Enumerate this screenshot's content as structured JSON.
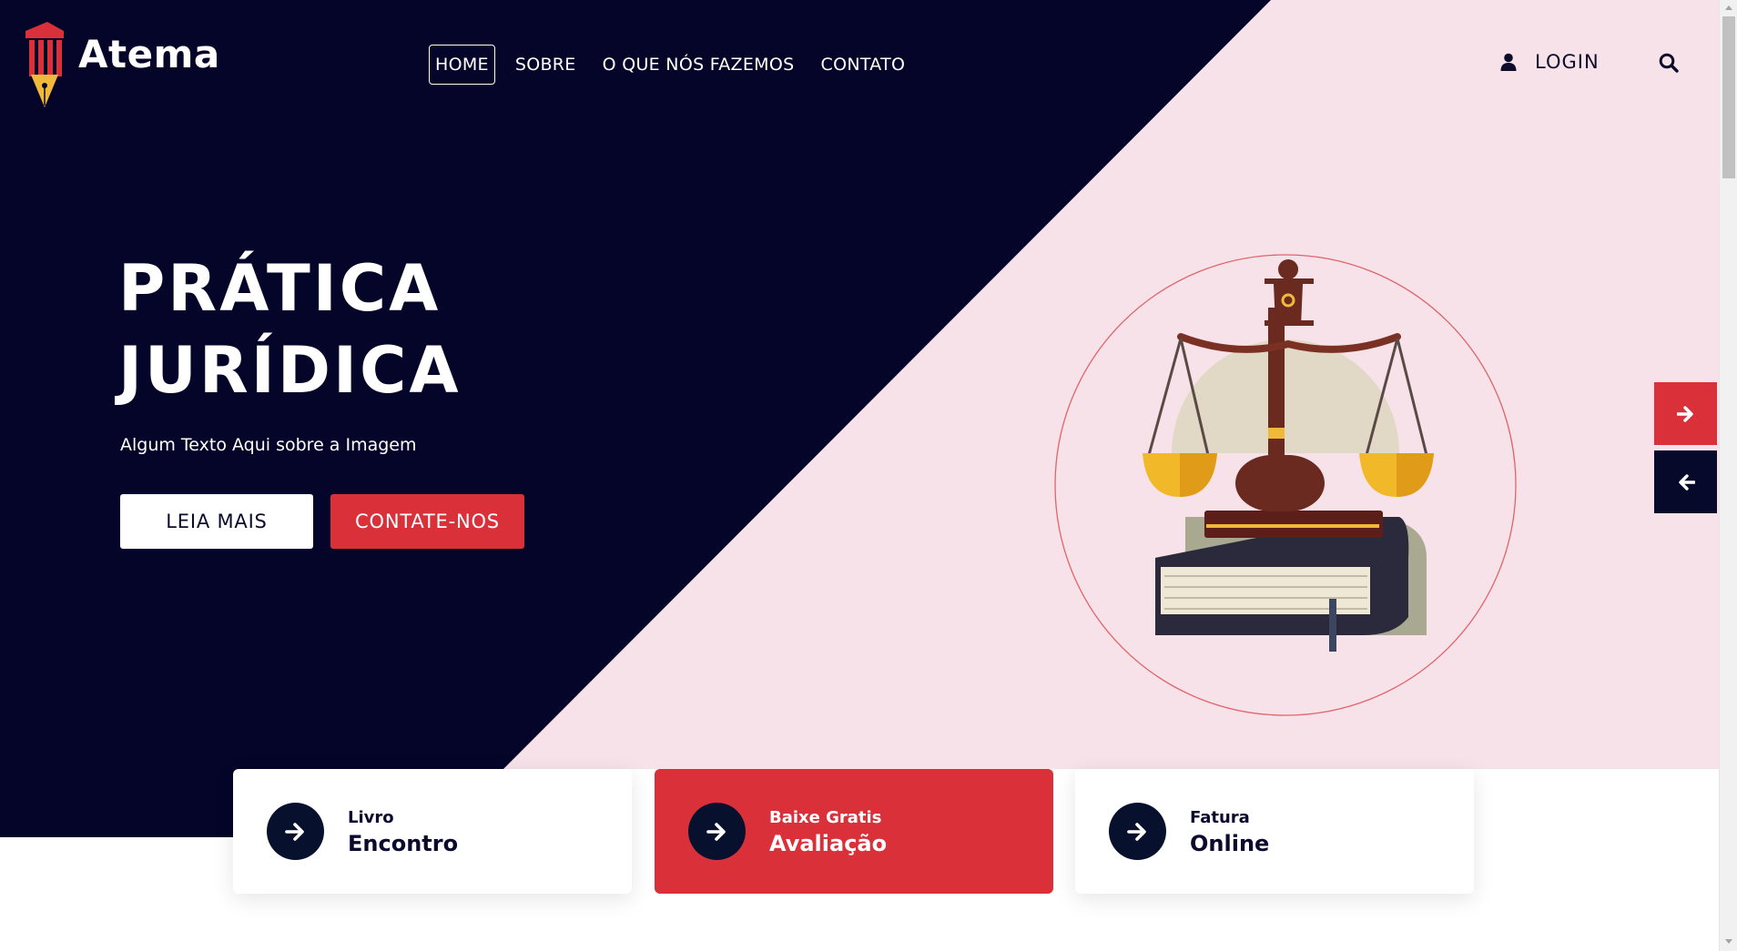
{
  "brand": {
    "name": "Atema"
  },
  "nav": {
    "items": [
      {
        "label": "HOME",
        "active": true
      },
      {
        "label": "SOBRE",
        "active": false
      },
      {
        "label": "O QUE NÓS FAZEMOS",
        "active": false
      },
      {
        "label": "CONTATO",
        "active": false
      }
    ]
  },
  "header": {
    "login_label": "LOGIN"
  },
  "hero": {
    "title_line1": "PRÁTICA",
    "title_line2": "JURÍDICA",
    "subtitle": "Algum Texto Aqui sobre a Imagem",
    "read_more_label": "LEIA MAIS",
    "contact_label": "CONTATE-NOS"
  },
  "cards": [
    {
      "small": "Livro",
      "big": "Encontro",
      "style": "light"
    },
    {
      "small": "Baixe Gratis",
      "big": "Avaliação",
      "style": "red"
    },
    {
      "small": "Fatura",
      "big": "Online",
      "style": "light"
    }
  ],
  "colors": {
    "navy": "#07092b",
    "accent_red": "#d9303a",
    "pink_bg": "#f6e2e8"
  },
  "icons": [
    "user-icon",
    "search-icon",
    "arrow-right-icon",
    "arrow-left-icon",
    "scales-of-justice-illustration",
    "atema-logo"
  ]
}
